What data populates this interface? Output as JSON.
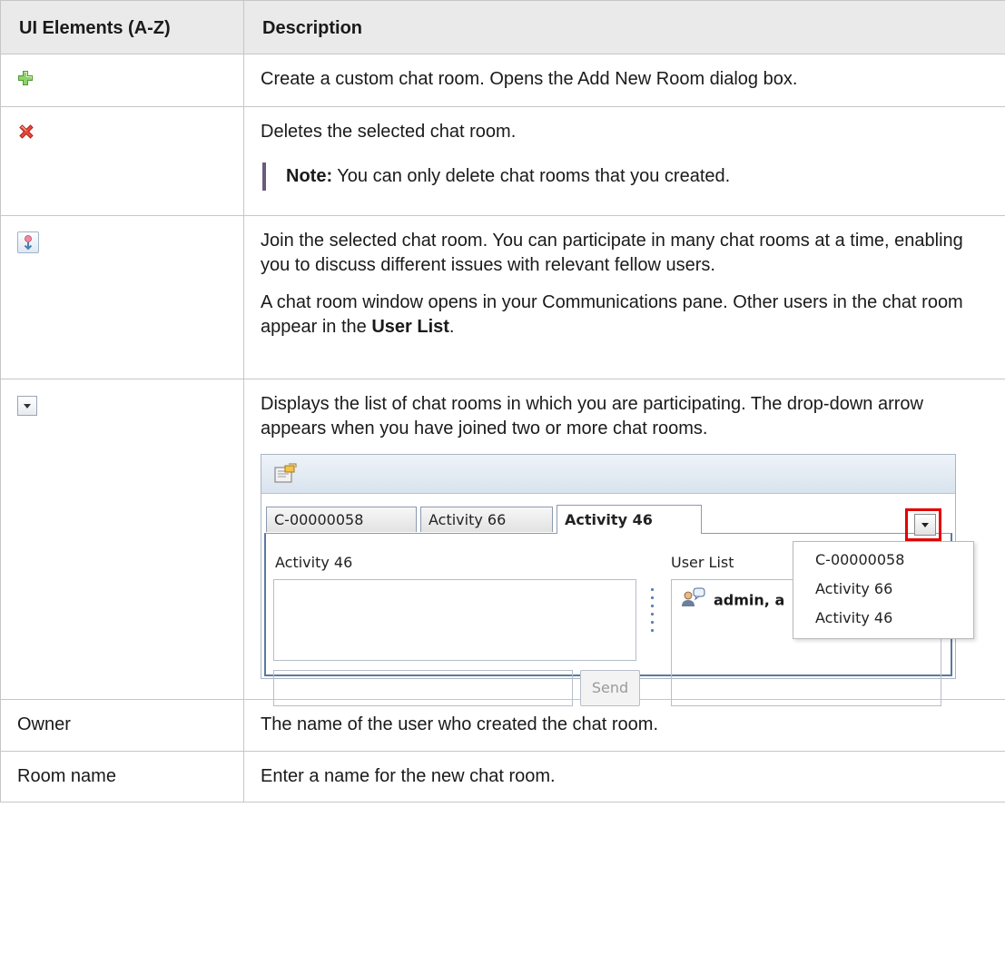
{
  "table": {
    "headers": [
      "UI Elements (A-Z)",
      "Description"
    ],
    "rows": {
      "add": {
        "icon": "add-plus-icon",
        "desc": "Create a custom chat room. Opens the Add New Room dialog box."
      },
      "delete": {
        "icon": "delete-x-icon",
        "desc": "Deletes the selected chat room.",
        "note_label": "Note:",
        "note_text": " You can only delete chat rooms that you created."
      },
      "join": {
        "icon": "join-room-icon",
        "p1": "Join the selected chat room. You can participate in many chat rooms at a time, enabling you to discuss different issues with relevant fellow users.",
        "p2_a": "A chat room window opens in your Communications pane. Other users in the chat room appear in the ",
        "p2_b": "User List",
        "p2_c": "."
      },
      "dropdown": {
        "icon": "dropdown-arrow-icon",
        "desc": "Displays the list of chat rooms in which you are participating. The drop-down arrow appears when you have joined two or more chat rooms.",
        "screenshot": {
          "tabs": [
            "C-00000058",
            "Activity 66",
            "Activity 46"
          ],
          "active_tab": "Activity 46",
          "room_label": "Activity 46",
          "user_list_label": "User List",
          "user_entry": "admin, a",
          "send_label": "Send",
          "menu_items": [
            "C-00000058",
            "Activity 66",
            "Activity 46"
          ]
        }
      },
      "owner": {
        "element": "Owner",
        "desc": "The name of the user who created the chat room."
      },
      "room_name": {
        "element": "Room name",
        "desc": "Enter a name for the new chat room."
      }
    }
  },
  "colors": {
    "header_bg": "#eaeaea",
    "border": "#c6c6c6",
    "note_bar": "#6b5b7b",
    "highlight_red": "#e30000"
  }
}
